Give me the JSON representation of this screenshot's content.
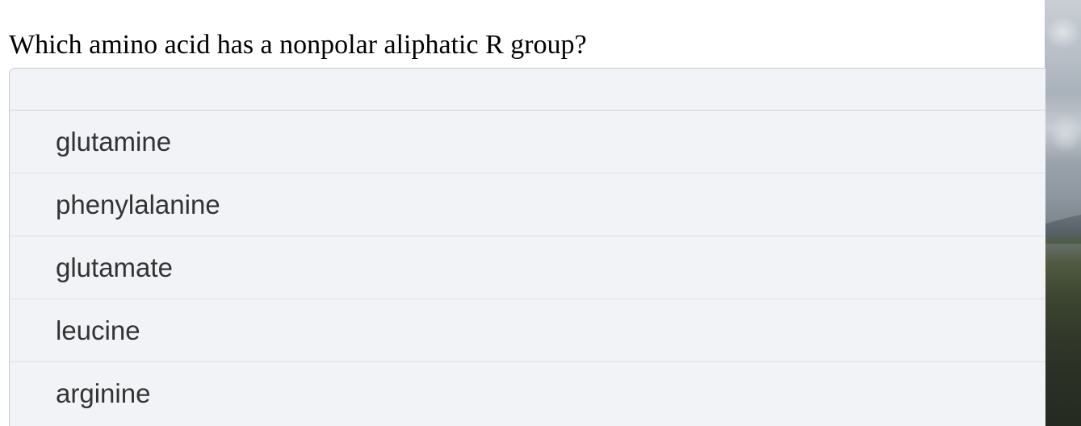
{
  "question": {
    "text": "Which amino acid has a nonpolar aliphatic R group?"
  },
  "options": [
    {
      "label": "glutamine"
    },
    {
      "label": "phenylalanine"
    },
    {
      "label": "glutamate"
    },
    {
      "label": "leucine"
    },
    {
      "label": "arginine"
    }
  ],
  "colors": {
    "options_background": "#f2f3f7",
    "option_text": "#333333",
    "question_text": "#000000"
  }
}
